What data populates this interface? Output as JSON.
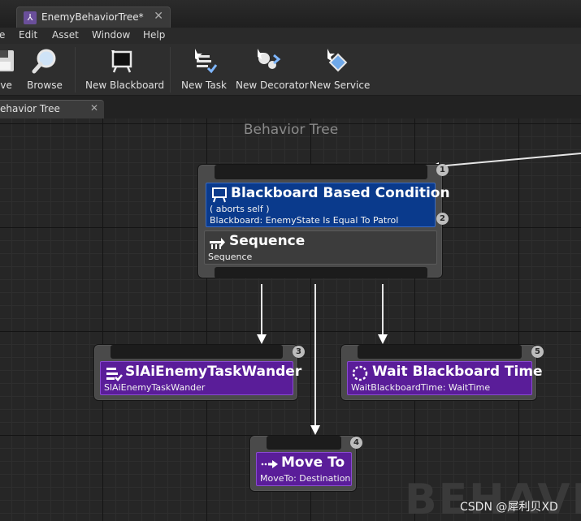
{
  "window": {
    "tab_label": "EnemyBehaviorTree*",
    "tab_close": "✕"
  },
  "menu": [
    "e",
    "Edit",
    "Asset",
    "Window",
    "Help"
  ],
  "toolbar": {
    "save_label": "ave",
    "browse_label": "Browse",
    "new_blackboard_label": "New Blackboard",
    "new_task_label": "New Task",
    "new_decorator_label": "New Decorator",
    "new_service_label": "New Service"
  },
  "editor_tab": {
    "label": "ehavior Tree",
    "close": "✕"
  },
  "graph": {
    "title": "Behavior Tree",
    "watermark": "BEHAVIO",
    "credit": "CSDN @犀利贝XD"
  },
  "nodes": {
    "root_decorator": {
      "title": "Blackboard Based Condition",
      "sub1": "( aborts self )",
      "sub2": "Blackboard: EnemyState Is Equal To Patrol",
      "index": "2"
    },
    "sequence": {
      "title": "Sequence",
      "sub": "Sequence",
      "index": "1"
    },
    "wander": {
      "title": "SlAiEnemyTaskWander",
      "sub": "SlAiEnemyTaskWander",
      "index": "3"
    },
    "move_to": {
      "title": "Move To",
      "sub": "MoveTo: Destination",
      "index": "4"
    },
    "wait": {
      "title": "Wait Blackboard Time",
      "sub": "WaitBlackboardTime: WaitTime",
      "index": "5"
    }
  },
  "colors": {
    "decorator": "#0a3a8c",
    "task": "#5a1d99",
    "composite": "#3c3c3c",
    "graph_bg": "#262626"
  }
}
